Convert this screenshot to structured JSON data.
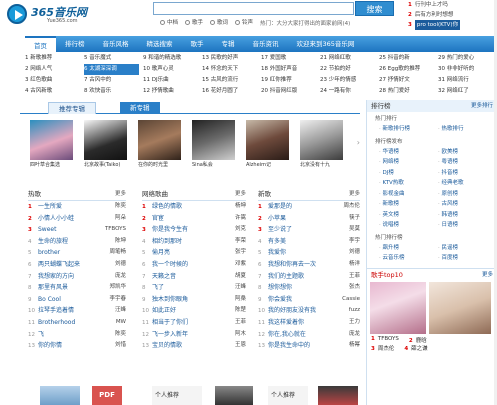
{
  "header": {
    "logo_name": "365音乐网",
    "logo_sub": "Yue365.com",
    "search_button": "搜索",
    "search_options": [
      "中档",
      "歌手",
      "歌词",
      "铃声"
    ],
    "hot_words": "热门：大分大家打得出的面家前网(4)"
  },
  "top_rank": [
    {
      "n": "1",
      "t": "行刊中上才吗"
    },
    {
      "n": "2",
      "t": "后有方利时想想"
    },
    {
      "n": "3",
      "t": "pro tool(KTV)你"
    }
  ],
  "nav": [
    "首页",
    "排行榜",
    "音乐风格",
    "精选搜索",
    "歌手",
    "专辑",
    "音乐资讯",
    "欢迎来到365音乐网"
  ],
  "subnav": [
    [
      "1 新歌推荐",
      "2 网络人气",
      "3 红色歌曲",
      "4 古风新歌"
    ],
    [
      "5 音乐魔式",
      "6 太湖深深调",
      "7 古风中的",
      "8 欢快音乐"
    ],
    [
      "9 和谐的精选歌",
      "10 歌声心灵",
      "11 DJ乐曲",
      "12 抒情歌曲"
    ],
    [
      "13 民歌的好声",
      "14 怀念的天下",
      "15 古风的流行",
      "16 花好月圆了"
    ],
    [
      "17 爱国歌",
      "18 外国好声音",
      "19 红你推荐",
      "20 抖音网红版"
    ],
    [
      "21 网络红歌",
      "22 节拍的好",
      "23 少年的情感",
      "24 一路有你"
    ],
    [
      "25 抖音的新",
      "26 Egg歌的推荐",
      "27 抒情好文",
      "28 热门爱好"
    ],
    [
      "29 热门的爱心",
      "30 非非好听的",
      "31 网络流行",
      "32 网络红了"
    ]
  ],
  "tabs": {
    "recommend": "推荐专辑",
    "new": "新专辑"
  },
  "covers": [
    {
      "cap": "四叶草合集选"
    },
    {
      "cap": "北京故事(Taiko)"
    },
    {
      "cap": "在你的时光里"
    },
    {
      "cap": "Sina私会"
    },
    {
      "cap": "Alzheim记"
    },
    {
      "cap": "北京没有十九"
    }
  ],
  "lists": [
    {
      "title": "热歌",
      "more": "更多",
      "rows": [
        [
          "1",
          "一生所爱",
          "陈奕"
        ],
        [
          "2",
          "小情人小小蛙",
          "阿朵"
        ],
        [
          "3",
          "Sweet",
          "TFBOYS"
        ],
        [
          "4",
          "生命的旅程",
          "陈坤"
        ],
        [
          "5",
          "brother",
          "周笔畅"
        ],
        [
          "6",
          "两只蝴蝶飞起来",
          "刘德"
        ],
        [
          "7",
          "我想家的方向",
          "庞龙"
        ],
        [
          "8",
          "那里有风景",
          "郑凯华"
        ],
        [
          "9",
          "Bo Cool",
          "李宇春"
        ],
        [
          "10",
          "拉琴手追着情",
          "汪峰"
        ],
        [
          "11",
          "Brotherhood",
          "MW"
        ],
        [
          "12",
          "飞",
          "陈奕"
        ],
        [
          "13",
          "你的你情",
          "刘惜"
        ]
      ]
    },
    {
      "title": "网络歌曲",
      "more": "更多",
      "rows": [
        [
          "1",
          "绿色的情歌",
          "杨坤"
        ],
        [
          "2",
          "官宦",
          "许嵩"
        ],
        [
          "3",
          "你是我今生有",
          "刘克"
        ],
        [
          "4",
          "相约到那时",
          "李荣"
        ],
        [
          "5",
          "偷月亮",
          "张宇"
        ],
        [
          "6",
          "我一个时候的",
          "邓紫"
        ],
        [
          "7",
          "天籁之音",
          "胡夏"
        ],
        [
          "8",
          "飞了",
          "汪峰"
        ],
        [
          "9",
          "独木到你眼角",
          "阿桑"
        ],
        [
          "10",
          "如此正好",
          "陈楚"
        ],
        [
          "11",
          "相当于了你们",
          "王菲"
        ],
        [
          "12",
          "飞一步入新年",
          "阿木"
        ],
        [
          "13",
          "宝贝的情歌",
          "王恩"
        ]
      ]
    },
    {
      "title": "新歌",
      "more": "更多",
      "rows": [
        [
          "1",
          "爱那是的",
          "周杰伦"
        ],
        [
          "2",
          "小苹果",
          "筷子"
        ],
        [
          "3",
          "至少说了",
          "吴莫"
        ],
        [
          "4",
          "有多美",
          "李宇"
        ],
        [
          "5",
          "我爱你",
          "刘德"
        ],
        [
          "6",
          "我想和你再去一次",
          "杨洋"
        ],
        [
          "7",
          "我们的主题歌",
          "王菲"
        ],
        [
          "8",
          "想你想你",
          "张杰"
        ],
        [
          "9",
          "你会爱我",
          "Cassie"
        ],
        [
          "10",
          "我的好朋友没有我",
          "fuzz"
        ],
        [
          "11",
          "我这样爱着你",
          "王力"
        ],
        [
          "12",
          "你在,我心就在",
          "庞龙"
        ],
        [
          "13",
          "你是我生命中的",
          "杨幂"
        ]
      ]
    }
  ],
  "sidebar": {
    "title": "排行榜",
    "more": "更多排行",
    "sections": [
      {
        "name": "热门排行",
        "items": [
          "新歌排行榜",
          "热歌排行"
        ]
      },
      {
        "name": "排行榜发布",
        "items": [
          "华语榜",
          "欧美榜",
          "网络榜",
          "粤语榜",
          "DJ榜",
          "抖音榜",
          "KTV热歌",
          "经典老歌",
          "影视金曲",
          "原创榜",
          "新歌榜",
          "古风榜",
          "英文榜",
          "韩语榜",
          "说唱榜",
          "日语榜"
        ]
      },
      {
        "name": "热门排行榜",
        "items": [
          "飙升榜",
          "民谣榜",
          "云音乐榜",
          "百度榜"
        ]
      }
    ],
    "photo_title": "歌手top10",
    "photo_more": "更多",
    "photo_ranks": [
      {
        "n": "1",
        "name": "TFBOYS",
        "n2": "2",
        "name2": "鹿晗"
      },
      {
        "n": "3",
        "name": "周杰伦",
        "n2": "4",
        "name2": "薛之谦"
      }
    ]
  },
  "bottom": {
    "pdf": "PDF",
    "mid": "个人推荐",
    "right": "个人推荐"
  },
  "colors": {
    "brand": "#1d74c0",
    "accent_red": "#dd0000",
    "link": "#1a5a9a"
  }
}
